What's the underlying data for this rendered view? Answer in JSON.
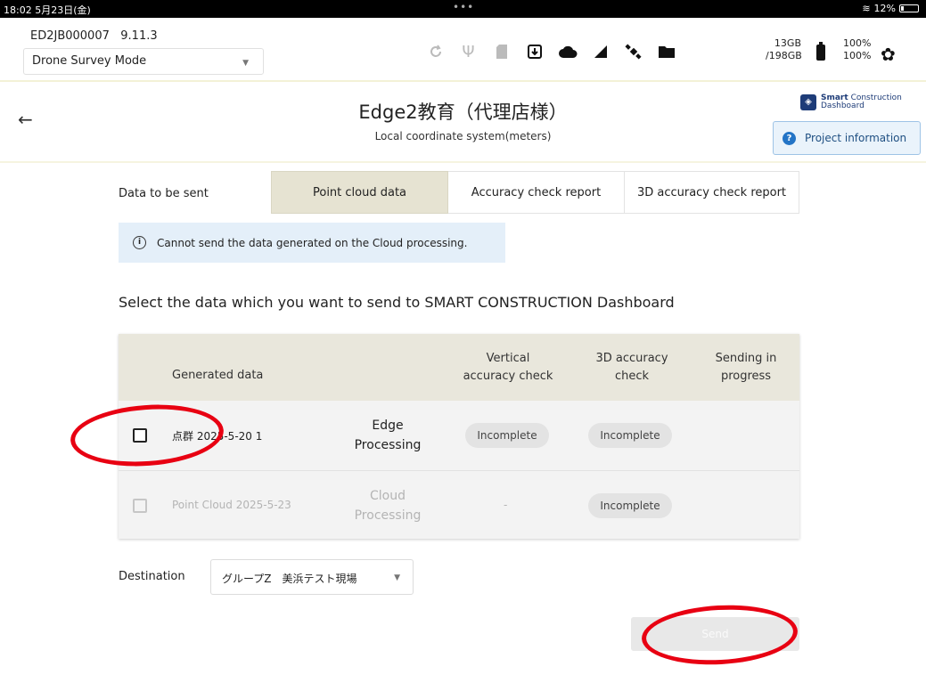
{
  "status_bar": {
    "time": "18:02 5月23日(金)",
    "dots": "•••",
    "battery": "12%"
  },
  "app_header": {
    "device_id": "ED2JB000007",
    "version": "9.11.3",
    "mode": "Drone Survey Mode",
    "storage_used": "13GB",
    "storage_total": "/198GB",
    "battery_1": "100%",
    "battery_2": "100%"
  },
  "page": {
    "title": "Edge2教育（代理店様）",
    "subtitle": "Local coordinate system(meters)",
    "logo_bold": "Smart",
    "logo_line1": "Construction",
    "logo_line2": "Dashboard",
    "project_info": "Project information"
  },
  "tabs": {
    "label": "Data to be sent",
    "items": [
      "Point cloud data",
      "Accuracy check report",
      "3D accuracy check report"
    ],
    "active_index": 0
  },
  "info_message": "Cannot send the data generated on the Cloud processing.",
  "instruction": "Select the data which you want to send to SMART CONSTRUCTION Dashboard",
  "table": {
    "headers": {
      "generated": "Generated data",
      "vertical_1": "Vertical",
      "vertical_2": "accuracy check",
      "accuracy3d_1": "3D accuracy",
      "accuracy3d_2": "check",
      "sending_1": "Sending in",
      "sending_2": "progress"
    },
    "rows": [
      {
        "name": "点群 2025-5-20 1",
        "proc_1": "Edge",
        "proc_2": "Processing",
        "vertical": "Incomplete",
        "accuracy3d": "Incomplete",
        "checked": false,
        "disabled": false
      },
      {
        "name": "Point Cloud 2025-5-23",
        "proc_1": "Cloud",
        "proc_2": "Processing",
        "vertical": "-",
        "accuracy3d": "Incomplete",
        "checked": false,
        "disabled": true
      }
    ]
  },
  "destination": {
    "label": "Destination",
    "value": "グループZ　美浜テスト現場"
  },
  "send_button": "Send",
  "colors": {
    "annotation": "#e80012",
    "active_tab": "#e6e3d2",
    "info_bg": "#e4eff9",
    "brand": "#1e3c78"
  }
}
